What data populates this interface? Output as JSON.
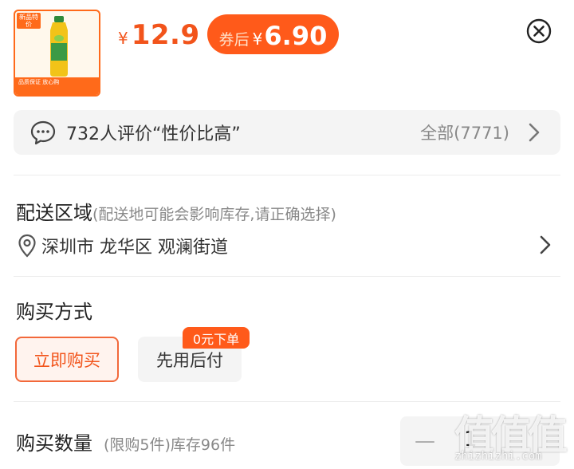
{
  "product": {
    "thumb_tag": "新品特价",
    "thumb_banner": "品质保证 放心购",
    "price_symbol": "¥",
    "price": "12.9",
    "coupon_label": "券后",
    "coupon_symbol": "¥",
    "coupon_price": "6.90"
  },
  "review": {
    "text": "732人评价“性价比高”",
    "all": "全部(7771)"
  },
  "delivery": {
    "title": "配送区域",
    "hint": "(配送地可能会影响库存,请正确选择)",
    "address": "深圳市 龙华区 观澜街道"
  },
  "purchase": {
    "title": "购买方式",
    "buy_now": "立即购买",
    "pay_later": "先用后付",
    "pay_later_badge": "0元下单"
  },
  "quantity": {
    "title": "购买数量",
    "limit": "(限购5件)库存96件",
    "minus": "—",
    "value": "1"
  },
  "watermark": {
    "glyphs": "值值值",
    "site": "zhizhizhi.com"
  },
  "colors": {
    "accent": "#ff5a1a",
    "price": "#f2541b"
  }
}
